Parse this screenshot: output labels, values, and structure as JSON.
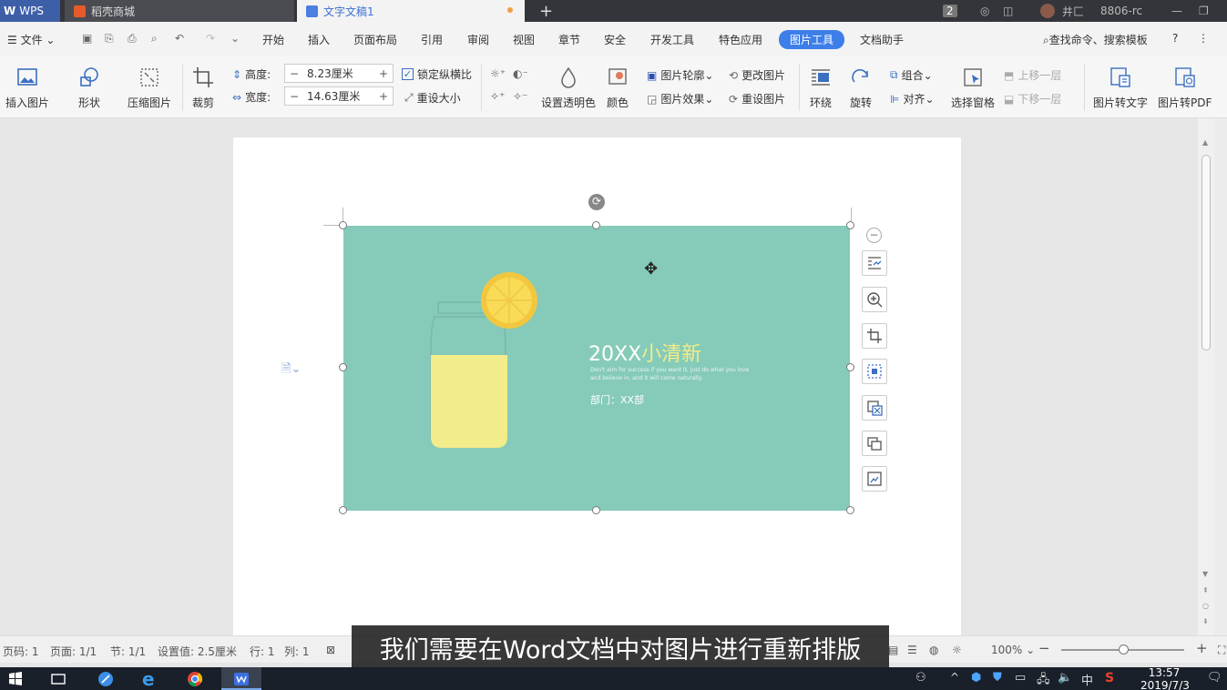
{
  "titlebar": {
    "app": "WPS",
    "tab1": "稻壳商城",
    "tab2": "文字文稿1",
    "badge": "2",
    "user": "井匚",
    "user_id": "8806-rc"
  },
  "menubar": {
    "file": "文件",
    "items": [
      "开始",
      "插入",
      "页面布局",
      "引用",
      "审阅",
      "视图",
      "章节",
      "安全",
      "开发工具",
      "特色应用",
      "图片工具",
      "文档助手"
    ],
    "active": "图片工具",
    "search": "查找命令、搜索模板",
    "help": "?"
  },
  "ribbon": {
    "insert_image": "插入图片",
    "shape": "形状",
    "compress": "压缩图片",
    "crop": "裁剪",
    "height_label": "高度:",
    "height_value": "8.23厘米",
    "width_label": "宽度:",
    "width_value": "14.63厘米",
    "lock_ratio": "锁定纵横比",
    "reset_size": "重设大小",
    "transparent": "设置透明色",
    "color": "颜色",
    "outline": "图片轮廓",
    "effect": "图片效果",
    "change_image": "更改图片",
    "reset_image": "重设图片",
    "wrap": "环绕",
    "rotate": "旋转",
    "group": "组合",
    "align": "对齐",
    "selection_pane": "选择窗格",
    "bring_forward": "上移一层",
    "send_backward": "下移一层",
    "to_text": "图片转文字",
    "to_pdf": "图片转PDF"
  },
  "image": {
    "title_num": "20XX",
    "title_txt": "小清新",
    "line1": "Don't aim for success if you want it, just do what you love",
    "line2": "and believe in, and it will come naturally.",
    "dept": "部门：XX部"
  },
  "status": {
    "page_code": "页码: 1",
    "page": "页面: 1/1",
    "section": "节: 1/1",
    "setting": "设置值: 2.5厘米",
    "row": "行: 1",
    "col": "列: 1",
    "zoom": "100%"
  },
  "subtitle": "我们需要在Word文档中对图片进行重新排版",
  "taskbar": {
    "ime": "中",
    "time": "13:57",
    "date": "2019/7/3"
  }
}
